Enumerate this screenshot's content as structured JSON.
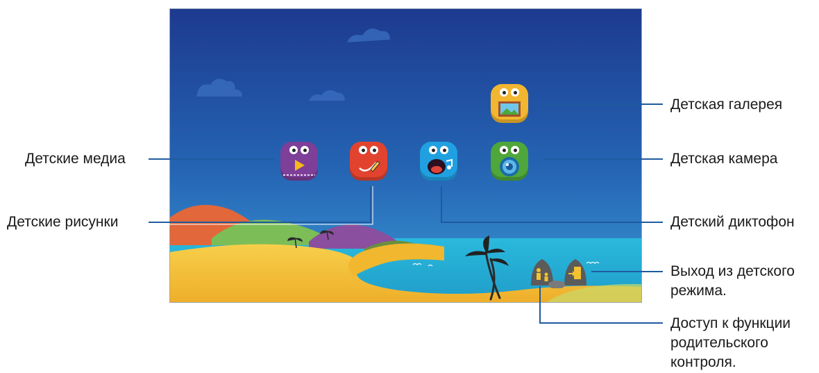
{
  "colors": {
    "sky_top": "#1e3f93",
    "sky_bottom": "#2f8fcf",
    "sea": "#28b0d6",
    "sand": "#f5c23a",
    "callout_line": "#1f5aa0"
  },
  "apps": [
    {
      "id": "kids-video",
      "icon": "play-icon",
      "color": "#7d3f98"
    },
    {
      "id": "kids-drawing",
      "icon": "pencil-icon",
      "color": "#e2432f"
    },
    {
      "id": "kids-voice",
      "icon": "music-note-icon",
      "color": "#20a0e0"
    },
    {
      "id": "kids-camera",
      "icon": "camera-lens-icon",
      "color": "#4fa63a"
    },
    {
      "id": "kids-gallery",
      "icon": "picture-icon",
      "color": "#f2b630"
    }
  ],
  "labels": {
    "media": "Детские медиа",
    "drawing": "Детские рисунки",
    "gallery": "Детская галерея",
    "camera": "Детская камера",
    "voice": "Детский диктофон",
    "exit_line1": "Выход из детского",
    "exit_line2": "режима.",
    "parental_line1": "Доступ к функции",
    "parental_line2": "родительского",
    "parental_line3": "контроля."
  }
}
